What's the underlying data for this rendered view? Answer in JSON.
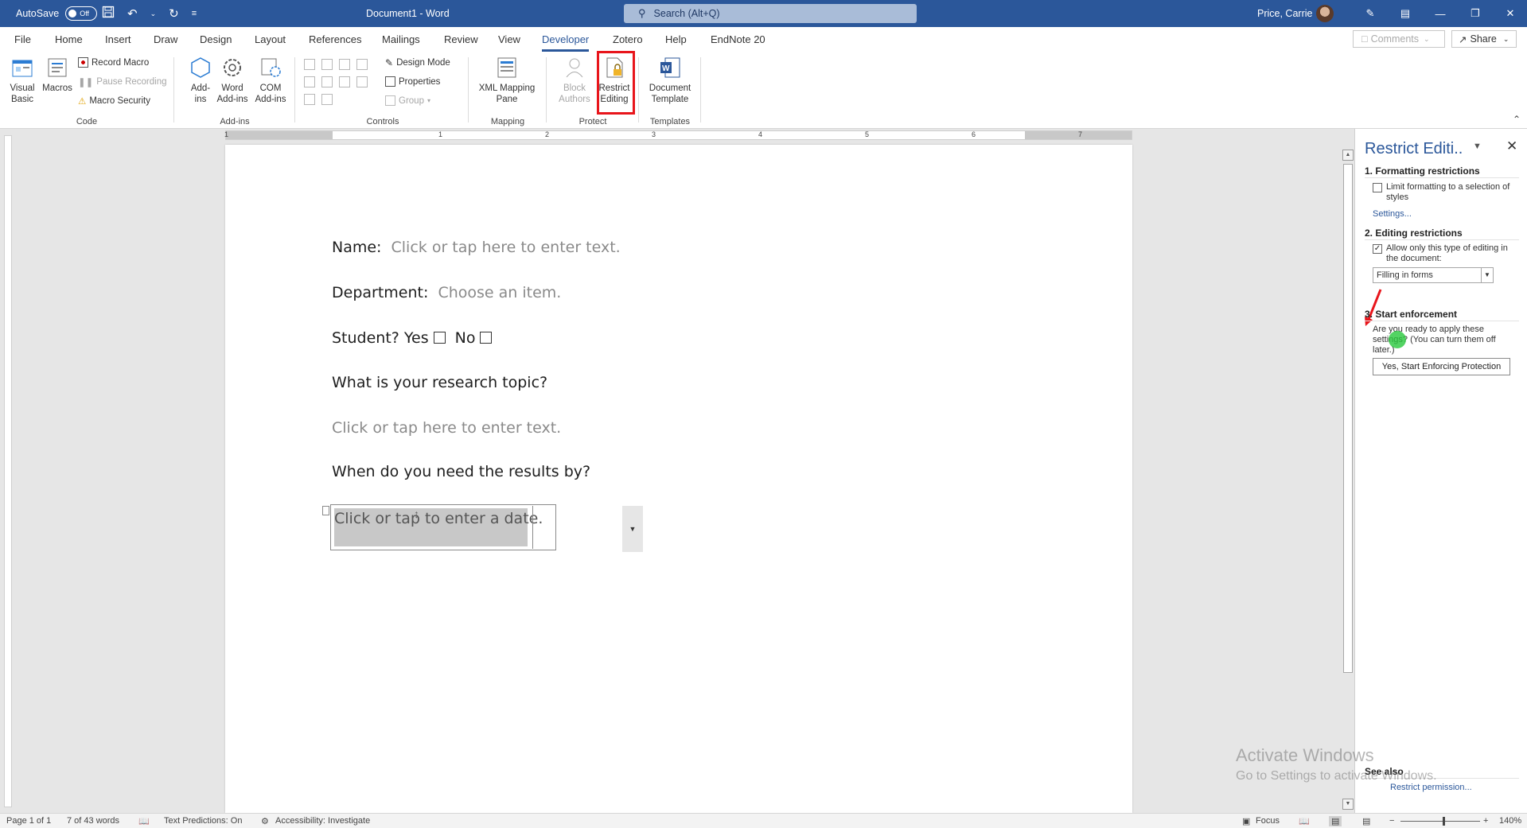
{
  "titlebar": {
    "autosave_label": "AutoSave",
    "autosave_state": "Off",
    "doc_title": "Document1  -  Word",
    "search_placeholder": "Search (Alt+Q)",
    "user_name": "Price, Carrie"
  },
  "tabs": [
    "File",
    "Home",
    "Insert",
    "Draw",
    "Design",
    "Layout",
    "References",
    "Mailings",
    "Review",
    "View",
    "Developer",
    "Zotero",
    "Help",
    "EndNote 20"
  ],
  "active_tab": "Developer",
  "tab_actions": {
    "comments": "Comments",
    "share": "Share"
  },
  "ribbon": {
    "code": {
      "label": "Code",
      "visual_basic": [
        "Visual",
        "Basic"
      ],
      "macros": "Macros",
      "record_macro": "Record Macro",
      "pause_recording": "Pause Recording",
      "macro_security": "Macro Security"
    },
    "addins": {
      "label": "Add-ins",
      "addins": [
        "Add-",
        "ins"
      ],
      "word_addins": [
        "Word",
        "Add-ins"
      ],
      "com_addins": [
        "COM",
        "Add-ins"
      ]
    },
    "controls": {
      "label": "Controls",
      "design_mode": "Design Mode",
      "properties": "Properties",
      "group": "Group"
    },
    "mapping": {
      "label": "Mapping",
      "xml_pane": [
        "XML Mapping",
        "Pane"
      ]
    },
    "protect": {
      "label": "Protect",
      "block_authors": [
        "Block",
        "Authors"
      ],
      "restrict_editing": [
        "Restrict",
        "Editing"
      ]
    },
    "templates": {
      "label": "Templates",
      "document_template": [
        "Document",
        "Template"
      ]
    }
  },
  "ruler_numbers": [
    "1",
    "1",
    "2",
    "3",
    "4",
    "5",
    "6",
    "7"
  ],
  "document": {
    "name_label": "Name:",
    "name_placeholder": "Click or tap here to enter text.",
    "department_label": "Department:",
    "department_placeholder": "Choose an item.",
    "student_label": "Student? Yes",
    "student_no": "No",
    "research_question": "What is your research topic?",
    "research_placeholder": "Click or tap here to enter text.",
    "results_question": "When do you need the results by?",
    "date_placeholder": "Click or tap to enter a date."
  },
  "pane": {
    "title": "Restrict Editi..",
    "section1": "1. Formatting restrictions",
    "limit_formatting": "Limit formatting to a selection of styles",
    "settings_link": "Settings...",
    "section2": "2. Editing restrictions",
    "allow_only": "Allow only this type of editing in the document:",
    "editing_type": "Filling in forms",
    "section3": "3. Start enforcement",
    "ready_text": "Are you ready to apply these settings? (You can turn them off later.)",
    "start_button": "Yes, Start Enforcing Protection",
    "see_also": "See also",
    "restrict_permission": "Restrict permission..."
  },
  "watermark": {
    "line1": "Activate Windows",
    "line2": "Go to Settings to activate Windows."
  },
  "status": {
    "page": "Page 1 of 1",
    "words": "7 of 43 words",
    "text_predictions": "Text Predictions: On",
    "accessibility": "Accessibility: Investigate",
    "focus": "Focus",
    "zoom": "140%"
  },
  "colors": {
    "brand_blue": "#2b579a",
    "highlight_red": "#e8151b"
  }
}
